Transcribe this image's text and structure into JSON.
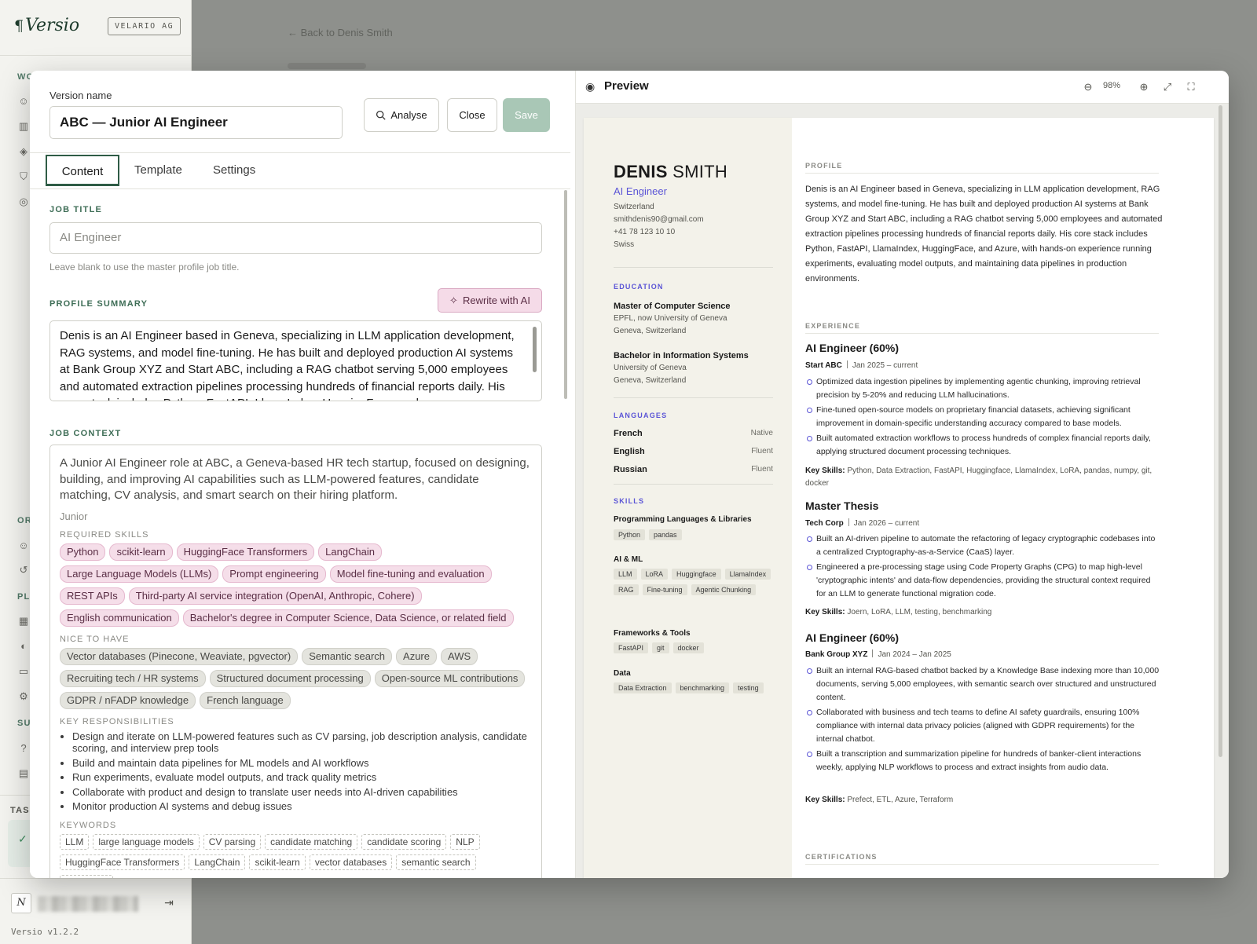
{
  "app": {
    "logo": "Versio",
    "org_badge": "VELARIO AG",
    "sections": [
      "WO",
      "OR",
      "PL",
      "SU"
    ],
    "tasks_label": "TASK",
    "user_initial": "N",
    "version": "Versio v1.2.2",
    "bg_breadcrumb": "Back to Denis Smith"
  },
  "editor": {
    "version_name_label": "Version name",
    "version_name_value": "ABC — Junior AI Engineer",
    "buttons": {
      "analyse": "Analyse",
      "close": "Close",
      "save": "Save"
    },
    "tabs": [
      "Content",
      "Template",
      "Settings"
    ],
    "job_title_label": "JOB TITLE",
    "job_title_placeholder": "AI Engineer",
    "job_title_hint": "Leave blank to use the master profile job title.",
    "profile_summary_label": "PROFILE SUMMARY",
    "rewrite_label": "Rewrite with AI",
    "profile_summary_text": "Denis is an AI Engineer based in Geneva, specializing in LLM application development, RAG systems, and model fine-tuning. He has built and deployed production AI systems at Bank Group XYZ and Start ABC, including a RAG chatbot serving 5,000 employees and automated extraction pipelines processing hundreds of financial reports daily. His core stack includes Python, FastAPI, LlamaIndex, HuggingFace, and",
    "job_context_label": "JOB CONTEXT",
    "job_context": {
      "description": "A Junior AI Engineer role at ABC, a Geneva-based HR tech startup, focused on designing, building, and improving AI capabilities such as LLM-powered features, candidate matching, CV analysis, and smart search on their hiring platform.",
      "level": "Junior",
      "required_label": "REQUIRED SKILLS",
      "required": [
        "Python",
        "scikit-learn",
        "HuggingFace Transformers",
        "LangChain",
        "Large Language Models (LLMs)",
        "Prompt engineering",
        "Model fine-tuning and evaluation",
        "REST APIs",
        "Third-party AI service integration (OpenAI, Anthropic, Cohere)",
        "English communication",
        "Bachelor's degree in Computer Science, Data Science, or related field"
      ],
      "nice_label": "NICE TO HAVE",
      "nice": [
        "Vector databases (Pinecone, Weaviate, pgvector)",
        "Semantic search",
        "Azure",
        "AWS",
        "Recruiting tech / HR systems",
        "Structured document processing",
        "Open-source ML contributions",
        "GDPR / nFADP knowledge",
        "French language"
      ],
      "resp_label": "KEY RESPONSIBILITIES",
      "responsibilities": [
        "Design and iterate on LLM-powered features such as CV parsing, job description analysis, candidate scoring, and interview prep tools",
        "Build and maintain data pipelines for ML models and AI workflows",
        "Run experiments, evaluate model outputs, and track quality metrics",
        "Collaborate with product and design to translate user needs into AI-driven capabilities",
        "Monitor production AI systems and debug issues"
      ],
      "keywords_label": "KEYWORDS",
      "keywords": [
        "LLM",
        "large language models",
        "CV parsing",
        "candidate matching",
        "candidate scoring",
        "NLP",
        "HuggingFace Transformers",
        "LangChain",
        "scikit-learn",
        "vector databases",
        "semantic search",
        "REST API"
      ]
    }
  },
  "preview": {
    "title": "Preview",
    "zoom": "98%",
    "cv": {
      "first_name": "DENIS",
      "last_name": "SMITH",
      "role": "AI Engineer",
      "contact": [
        "Switzerland",
        "smithdenis90@gmail.com",
        "+41 78 123 10 10",
        "Swiss"
      ],
      "education_label": "EDUCATION",
      "education": [
        {
          "degree": "Master of Computer Science",
          "school": "EPFL, now University of Geneva",
          "place": "Geneva, Switzerland"
        },
        {
          "degree": "Bachelor in Information Systems",
          "school": "University of Geneva",
          "place": "Geneva, Switzerland"
        }
      ],
      "languages_label": "LANGUAGES",
      "languages": [
        {
          "name": "French",
          "level": "Native"
        },
        {
          "name": "English",
          "level": "Fluent"
        },
        {
          "name": "Russian",
          "level": "Fluent"
        }
      ],
      "skills_label": "SKILLS",
      "skills": [
        {
          "category": "Programming Languages & Libraries",
          "tags": [
            "Python",
            "pandas"
          ]
        },
        {
          "category": "AI & ML",
          "tags": [
            "LLM",
            "LoRA",
            "Huggingface",
            "LlamaIndex",
            "RAG",
            "Fine-tuning",
            "Agentic Chunking"
          ]
        },
        {
          "category": "Frameworks & Tools",
          "tags": [
            "FastAPI",
            "git",
            "docker"
          ]
        },
        {
          "category": "Data",
          "tags": [
            "Data Extraction",
            "benchmarking",
            "testing"
          ]
        }
      ],
      "profile_label": "PROFILE",
      "profile": "Denis is an AI Engineer based in Geneva, specializing in LLM application development, RAG systems, and model fine-tuning. He has built and deployed production AI systems at Bank Group XYZ and Start ABC, including a RAG chatbot serving 5,000 employees and automated extraction pipelines processing hundreds of financial reports daily. His core stack includes Python, FastAPI, LlamaIndex, HuggingFace, and Azure, with hands-on experience running experiments, evaluating model outputs, and maintaining data pipelines in production environments.",
      "experience_label": "EXPERIENCE",
      "key_skills_label": "Key Skills:",
      "jobs": [
        {
          "title": "AI Engineer (60%)",
          "company": "Start ABC",
          "dates": "Jan 2025 – current",
          "bullets": [
            "Optimized data ingestion pipelines by implementing agentic chunking, improving retrieval precision by 5-20% and reducing LLM hallucinations.",
            "Fine-tuned open-source models on proprietary financial datasets, achieving significant improvement in domain-specific understanding accuracy compared to base models.",
            "Built automated extraction workflows to process hundreds of complex financial reports daily, applying structured document processing techniques."
          ],
          "key_skills": "Python, Data Extraction, FastAPI, Huggingface, LlamaIndex, LoRA, pandas, numpy, git, docker"
        },
        {
          "title": "Master Thesis",
          "company": "Tech Corp",
          "dates": "Jan 2026 – current",
          "bullets": [
            "Built an AI-driven pipeline to automate the refactoring of legacy cryptographic codebases into a centralized Cryptography-as-a-Service (CaaS) layer.",
            "Engineered a pre-processing stage using Code Property Graphs (CPG) to map high-level 'cryptographic intents' and data-flow dependencies, providing the structural context required for an LLM to generate functional migration code."
          ],
          "key_skills": "Joern, LoRA, LLM, testing, benchmarking"
        },
        {
          "title": "AI Engineer (60%)",
          "company": "Bank Group XYZ",
          "dates": "Jan 2024 – Jan 2025",
          "bullets": [
            "Built an internal RAG-based chatbot backed by a Knowledge Base indexing more than 10,000 documents, serving 5,000 employees, with semantic search over structured and unstructured content.",
            "Collaborated with business and tech teams to define AI safety guardrails, ensuring 100% compliance with internal data privacy policies (aligned with GDPR requirements) for the internal chatbot.",
            "Built a transcription and summarization pipeline for hundreds of banker-client interactions weekly, applying NLP workflows to process and extract insights from audio data."
          ],
          "key_skills": "Prefect, ETL, Azure, Terraform"
        }
      ],
      "certifications_label": "CERTIFICATIONS"
    }
  }
}
